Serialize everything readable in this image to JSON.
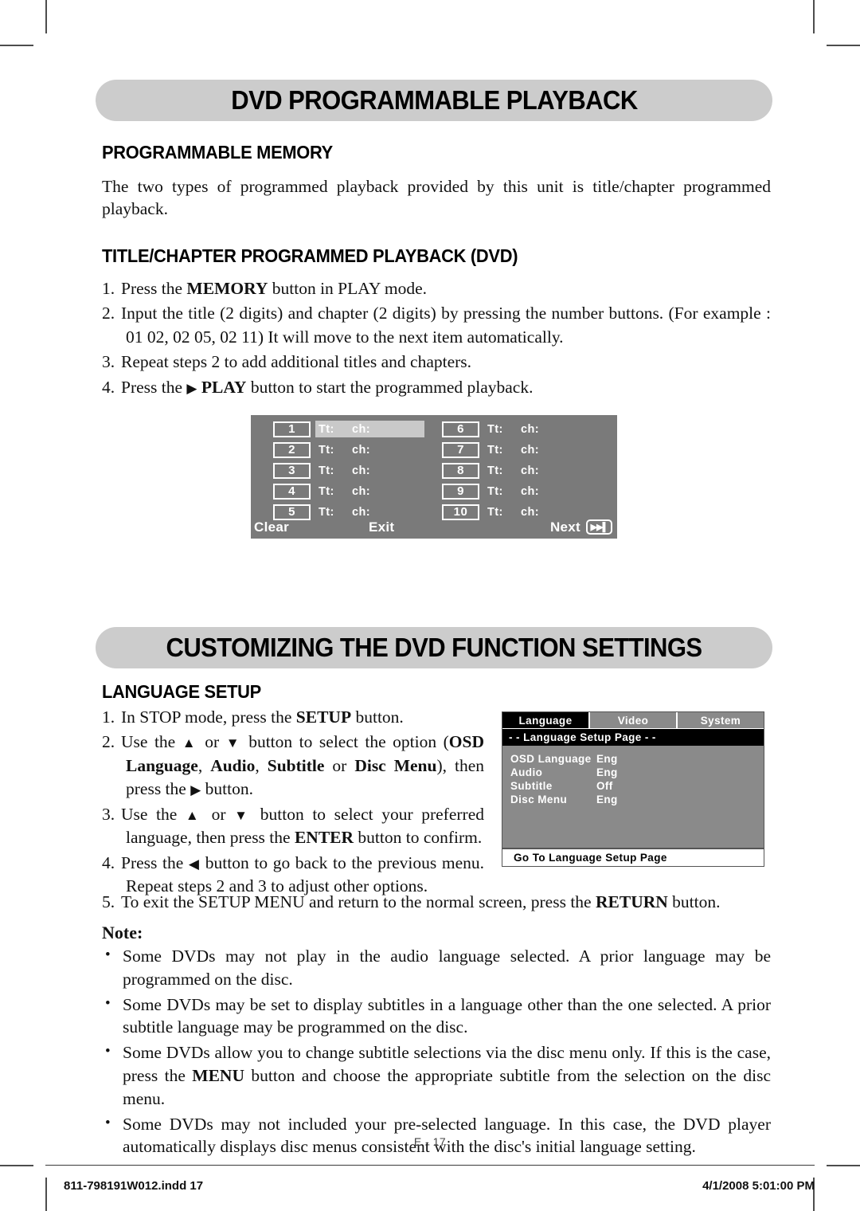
{
  "crop_marks": {
    "present": true
  },
  "section1": {
    "banner_title": "DVD PROGRAMMABLE PLAYBACK",
    "heading1": "PROGRAMMABLE MEMORY",
    "paragraph1": "The two types of programmed playback provided by this unit is title/chapter programmed playback.",
    "heading2": "TITLE/CHAPTER PROGRAMMED PLAYBACK (DVD)",
    "steps": [
      {
        "num": "1.",
        "html": "Press the <b>MEMORY</b> button in PLAY mode."
      },
      {
        "num": "2.",
        "html": "Input the title (2 digits) and chapter (2 digits) by pressing the number buttons. (For example : 01 02, 02 05, 02 11) It will move to the next item automatically."
      },
      {
        "num": "3.",
        "html": "Repeat steps 2 to add additional titles and chapters."
      },
      {
        "num": "4.",
        "html": "Press the <span class=\"tri\">&#9654;</span> <b>PLAY</b> button to start the programmed playback."
      }
    ]
  },
  "program_osd": {
    "rows_left": [
      {
        "no": "1",
        "tt": "Tt:",
        "ch": "ch:",
        "selected": true
      },
      {
        "no": "2",
        "tt": "Tt:",
        "ch": "ch:",
        "selected": false
      },
      {
        "no": "3",
        "tt": "Tt:",
        "ch": "ch:",
        "selected": false
      },
      {
        "no": "4",
        "tt": "Tt:",
        "ch": "ch:",
        "selected": false
      },
      {
        "no": "5",
        "tt": "Tt:",
        "ch": "ch:",
        "selected": false
      }
    ],
    "rows_right": [
      {
        "no": "6",
        "tt": "Tt:",
        "ch": "ch:",
        "selected": false
      },
      {
        "no": "7",
        "tt": "Tt:",
        "ch": "ch:",
        "selected": false
      },
      {
        "no": "8",
        "tt": "Tt:",
        "ch": "ch:",
        "selected": false
      },
      {
        "no": "9",
        "tt": "Tt:",
        "ch": "ch:",
        "selected": false
      },
      {
        "no": "10",
        "tt": "Tt:",
        "ch": "ch:",
        "selected": false
      }
    ],
    "footer": {
      "clear": "Clear",
      "exit": "Exit",
      "next": "Next",
      "skip_icon": "skip-forward-icon"
    },
    "colors": {
      "background": "#7a7a7a",
      "highlight": "#c9c9c9",
      "text": "#ffffff"
    }
  },
  "section2": {
    "banner_title": "CUSTOMIZING THE DVD FUNCTION SETTINGS",
    "heading1": "LANGUAGE SETUP",
    "steps": [
      {
        "num": "1.",
        "html": "In STOP mode, press the <b>SETUP</b> button."
      },
      {
        "num": "2.",
        "html": "Use the <span class=\"tri\">&#9650;</span> or <span class=\"tri\">&#9660;</span> button to select the option (<b>OSD Language</b>, <b>Audio</b>, <b>Subtitle</b> or <b>Disc Menu</b>), then press the <span class=\"tri\">&#9654;</span> button."
      },
      {
        "num": "3.",
        "html": "Use the <span class=\"tri\">&#9650;</span> or <span class=\"tri\">&#9660;</span> button to select your preferred language, then press the <b>ENTER</b> button to confirm."
      },
      {
        "num": "4.",
        "html": "Press the <span class=\"tri\">&#9664;</span> button to go back to the previous menu. Repeat steps 2 and 3 to adjust other options."
      }
    ],
    "step5": {
      "num": "5.",
      "html": "To exit the SETUP MENU and return to the normal screen, press the <b>RETURN</b> button."
    },
    "note_label": "Note:",
    "notes": [
      "Some DVDs may not play in the audio language selected. A prior language may be programmed on the disc.",
      "Some DVDs may be set to display subtitles in a language other than the one selected. A prior subtitle language may be programmed on the disc.",
      "Some DVDs allow you to change subtitle selections via the disc menu only. If this is the case, press the <b>MENU</b> button and choose the appropriate subtitle from the selection on the disc menu.",
      "Some DVDs may not included your pre-selected language. In this case, the DVD player automatically displays disc menus consistent with the disc's initial language setting."
    ]
  },
  "language_osd": {
    "tabs": [
      {
        "label": "Language",
        "active": true
      },
      {
        "label": "Video",
        "active": false
      },
      {
        "label": "System",
        "active": false
      }
    ],
    "title": "- - Language Setup Page - -",
    "items": [
      {
        "key": "OSD Language",
        "value": "Eng"
      },
      {
        "key": "Audio",
        "value": "Eng"
      },
      {
        "key": "Subtitle",
        "value": "Off"
      },
      {
        "key": "Disc Menu",
        "value": "Eng"
      }
    ],
    "footer": "Go To Language Setup Page",
    "colors": {
      "active_tab": "#000000",
      "inactive_tab": "#8a8a8a",
      "body": "#8a8a8a"
    }
  },
  "footer": {
    "page_number": "E - 17",
    "file_name": "811-798191W012.indd   17",
    "timestamp": "4/1/2008   5:01:00 PM"
  }
}
